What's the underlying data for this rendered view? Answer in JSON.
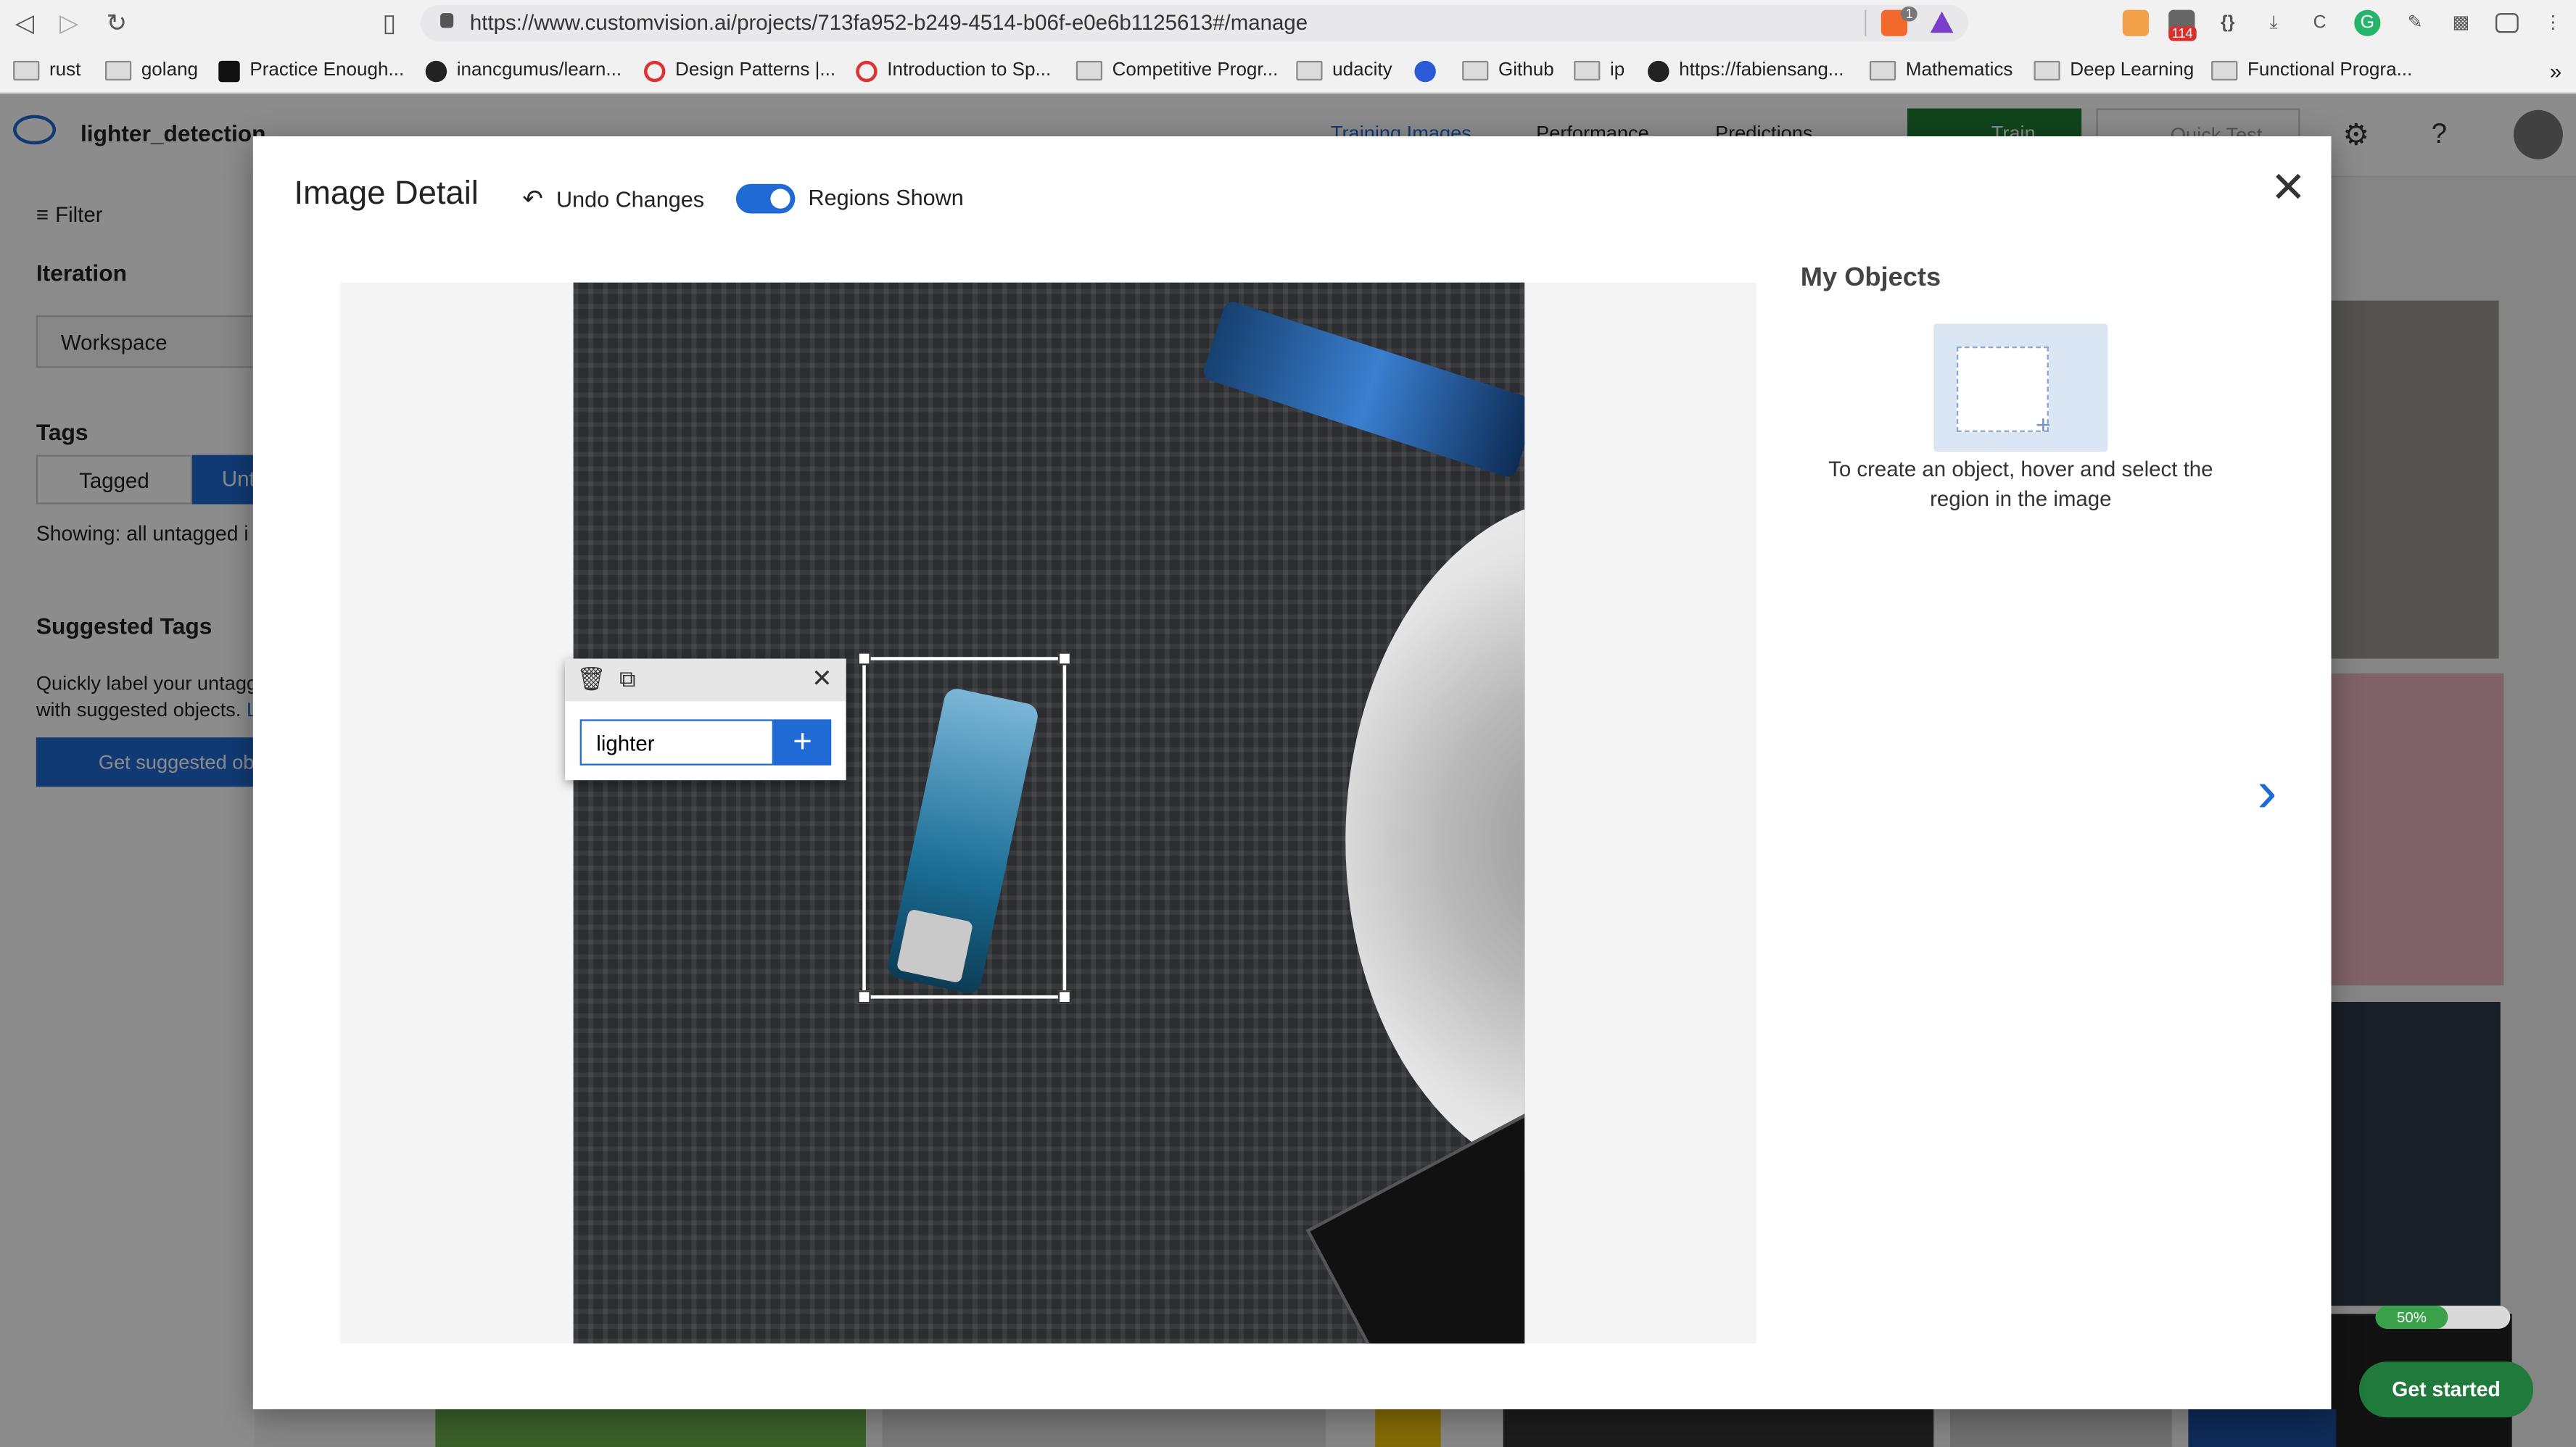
{
  "browser": {
    "url": "https://www.customvision.ai/projects/713fa952-b249-4514-b06f-e0e6b1125613#/manage",
    "notification_badge": "114",
    "shield_badge": "1",
    "bookmarks": [
      {
        "label": "rust",
        "icon": "folder-icon"
      },
      {
        "label": "golang",
        "icon": "folder-icon"
      },
      {
        "label": "Practice Enough...",
        "icon": "site-icon"
      },
      {
        "label": "inancgumus/learn...",
        "icon": "github-icon"
      },
      {
        "label": "Design Patterns |...",
        "icon": "site-icon"
      },
      {
        "label": "Introduction to Sp...",
        "icon": "site-icon"
      },
      {
        "label": "Competitive Progr...",
        "icon": "folder-icon"
      },
      {
        "label": "udacity",
        "icon": "folder-icon"
      },
      {
        "label": "",
        "icon": "site-icon"
      },
      {
        "label": "Github",
        "icon": "folder-icon"
      },
      {
        "label": "ip",
        "icon": "folder-icon"
      },
      {
        "label": "https://fabiensang...",
        "icon": "github-icon"
      },
      {
        "label": "Mathematics",
        "icon": "folder-icon"
      },
      {
        "label": "Deep Learning",
        "icon": "folder-icon"
      },
      {
        "label": "Functional Progra...",
        "icon": "folder-icon"
      }
    ],
    "more_label": "»"
  },
  "app": {
    "project_name": "lighter_detection",
    "nav": [
      "Training Images",
      "Performance",
      "Predictions"
    ],
    "train_label": "Train",
    "quick_test_label": "Quick Test",
    "sidebar": {
      "filter_label": "Filter",
      "iteration_heading": "Iteration",
      "iteration_value": "Workspace",
      "tags_heading": "Tags",
      "tagged_label": "Tagged",
      "untagged_label": "Unt",
      "showing_text": "Showing: all untagged i",
      "suggested_heading": "Suggested Tags",
      "suggested_text_1": "Quickly label your untagg",
      "suggested_text_2": "with suggested objects.",
      "suggested_link": "Le",
      "get_suggested_label": "Get suggested obj"
    },
    "progress_badge": "50%",
    "get_started_label": "Get started"
  },
  "modal": {
    "title": "Image Detail",
    "undo_label": "Undo Changes",
    "regions_label": "Regions Shown",
    "regions_on": true,
    "my_objects_heading": "My Objects",
    "my_objects_hint": "To create an object, hover and select the region in the image",
    "tag_input_value": "lighter",
    "tag_input_placeholder": ""
  },
  "colors": {
    "accent": "#1f6ad4",
    "train_green": "#1e7e34",
    "get_started": "#1f7a3c"
  }
}
